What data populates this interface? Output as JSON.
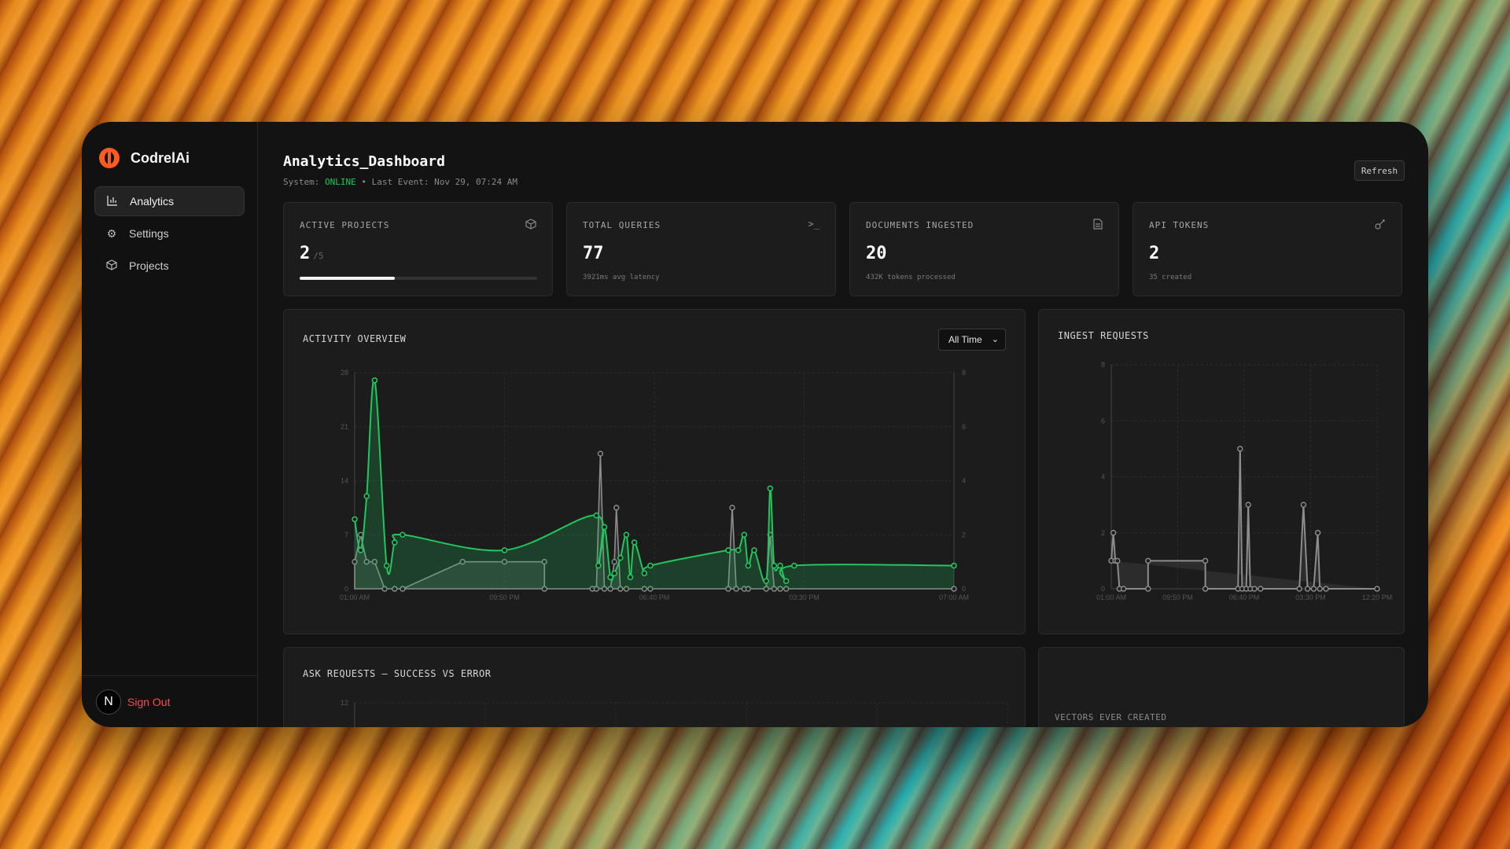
{
  "brand": {
    "name": "CodrelAi"
  },
  "sidebar": {
    "items": [
      {
        "label": "Analytics",
        "icon": "bar-chart-icon",
        "active": true
      },
      {
        "label": "Settings",
        "icon": "gear-icon",
        "active": false
      },
      {
        "label": "Projects",
        "icon": "cube-icon",
        "active": false
      }
    ],
    "user_initial": "N",
    "sign_out": "Sign Out"
  },
  "header": {
    "title": "Analytics_Dashboard",
    "status_prefix": "System:",
    "status": "ONLINE",
    "last_event": "• Last Event: Nov 29, 07:24 AM",
    "refresh": "Refresh"
  },
  "stats": {
    "projects": {
      "label": "ACTIVE PROJECTS",
      "value": "2",
      "max": "/5",
      "progress": 0.4
    },
    "queries": {
      "label": "TOTAL QUERIES",
      "value": "77",
      "sub": "3921ms avg latency"
    },
    "documents": {
      "label": "DOCUMENTS INGESTED",
      "value": "20",
      "sub": "432K tokens processed"
    },
    "tokens": {
      "label": "API TOKENS",
      "value": "2",
      "sub": "35 created"
    }
  },
  "panels": {
    "activity": {
      "title": "ACTIVITY OVERVIEW",
      "range": "All Time"
    },
    "ingest": {
      "title": "INGEST REQUESTS"
    },
    "ask": {
      "title": "ASK REQUESTS — SUCCESS VS ERROR"
    },
    "vectors": {
      "title": "VECTORS EVER CREATED"
    }
  },
  "colors": {
    "accent_green": "#22c55e",
    "danger": "#ff4a4a",
    "brand": "#ff5a1f",
    "gray_series": "#8c8c8c"
  },
  "chart_data": [
    {
      "type": "area",
      "title": "ACTIVITY OVERVIEW",
      "x_ticks": [
        "01:00 AM",
        "09:50 PM",
        "06:40 PM",
        "03:30 PM",
        "07:00 AM"
      ],
      "y_left_ticks": [
        0,
        7,
        14,
        21,
        28
      ],
      "y_right_ticks": [
        0,
        2,
        4,
        6,
        8
      ],
      "ylim_left": [
        0,
        28
      ],
      "ylim_right": [
        0,
        8
      ],
      "series": [
        {
          "axis": "left",
          "points": [
            [
              0.0,
              9
            ],
            [
              0.3,
              5
            ],
            [
              0.6,
              12
            ],
            [
              1.0,
              27
            ],
            [
              1.6,
              3
            ],
            [
              2.0,
              6
            ],
            [
              2.4,
              7
            ],
            [
              7.5,
              5
            ],
            [
              12.1,
              9.5
            ],
            [
              12.2,
              3
            ],
            [
              12.5,
              8
            ],
            [
              12.8,
              1.5
            ],
            [
              13.0,
              2
            ],
            [
              13.3,
              4
            ],
            [
              13.6,
              7
            ],
            [
              13.8,
              1.5
            ],
            [
              14.0,
              6
            ],
            [
              14.5,
              2
            ],
            [
              14.8,
              3
            ],
            [
              18.7,
              5
            ],
            [
              19.2,
              5
            ],
            [
              19.5,
              7
            ],
            [
              19.7,
              3
            ],
            [
              20.0,
              5
            ],
            [
              20.6,
              1
            ],
            [
              20.8,
              13
            ],
            [
              21.0,
              3
            ],
            [
              21.3,
              3
            ],
            [
              21.6,
              1
            ],
            [
              22.0,
              3
            ],
            [
              30.0,
              3
            ]
          ]
        },
        {
          "axis": "right",
          "points": [
            [
              0,
              1
            ],
            [
              0.3,
              2
            ],
            [
              0.6,
              1
            ],
            [
              1.0,
              1
            ],
            [
              1.5,
              0
            ],
            [
              2.0,
              0
            ],
            [
              2.4,
              0
            ],
            [
              5.4,
              1
            ],
            [
              7.5,
              1
            ],
            [
              9.5,
              1
            ],
            [
              9.5,
              0
            ],
            [
              11.9,
              0
            ],
            [
              12.1,
              0
            ],
            [
              12.3,
              5
            ],
            [
              12.5,
              0
            ],
            [
              12.8,
              0
            ],
            [
              13.0,
              1
            ],
            [
              13.1,
              3
            ],
            [
              13.3,
              0
            ],
            [
              13.6,
              0
            ],
            [
              14.5,
              0
            ],
            [
              14.8,
              0
            ],
            [
              18.7,
              0
            ],
            [
              18.9,
              3
            ],
            [
              19.1,
              0
            ],
            [
              19.5,
              0
            ],
            [
              19.7,
              0
            ],
            [
              20.6,
              0
            ],
            [
              20.8,
              2
            ],
            [
              21.0,
              0
            ],
            [
              21.3,
              0
            ],
            [
              21.6,
              0
            ],
            [
              30.0,
              0
            ]
          ]
        }
      ]
    },
    {
      "type": "line",
      "title": "INGEST REQUESTS",
      "x_ticks": [
        "01:00 AM",
        "09:50 PM",
        "06:40 PM",
        "03:30 PM",
        "12:20 PM"
      ],
      "y_ticks": [
        0,
        2,
        4,
        6,
        8
      ],
      "ylim": [
        0,
        8
      ],
      "series": [
        {
          "points": [
            [
              0,
              1
            ],
            [
              0.1,
              2
            ],
            [
              0.2,
              1
            ],
            [
              0.3,
              1
            ],
            [
              0.4,
              0
            ],
            [
              0.6,
              0
            ],
            [
              1.8,
              0
            ],
            [
              1.8,
              1
            ],
            [
              4.6,
              1
            ],
            [
              4.6,
              0
            ],
            [
              6.2,
              0
            ],
            [
              6.3,
              5
            ],
            [
              6.4,
              0
            ],
            [
              6.6,
              0
            ],
            [
              6.7,
              3
            ],
            [
              6.8,
              0
            ],
            [
              7.0,
              0
            ],
            [
              7.3,
              0
            ],
            [
              9.2,
              0
            ],
            [
              9.4,
              3
            ],
            [
              9.6,
              0
            ],
            [
              9.9,
              0
            ],
            [
              10.1,
              2
            ],
            [
              10.2,
              0
            ],
            [
              10.5,
              0
            ],
            [
              13.0,
              0
            ]
          ]
        }
      ]
    },
    {
      "type": "line",
      "title": "ASK REQUESTS — SUCCESS VS ERROR",
      "y_ticks": [
        12
      ],
      "series": []
    }
  ]
}
